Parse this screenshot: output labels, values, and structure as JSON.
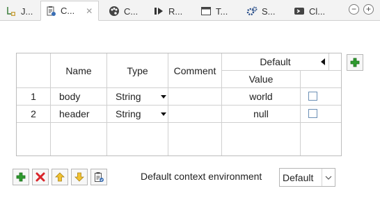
{
  "tabs": [
    {
      "label": "J...",
      "icon": "job-icon"
    },
    {
      "label": "C...",
      "icon": "contexts-icon"
    },
    {
      "label": "C...",
      "icon": "palette-icon"
    },
    {
      "label": "R...",
      "icon": "run-icon"
    },
    {
      "label": "T...",
      "icon": "window-icon"
    },
    {
      "label": "S...",
      "icon": "settings-icon"
    },
    {
      "label": "Cl...",
      "icon": "cloud-icon"
    }
  ],
  "tab_close": "✕",
  "window": {
    "minimize": "−",
    "maximize": "+"
  },
  "table": {
    "headers": {
      "name": "Name",
      "type": "Type",
      "comment": "Comment",
      "default": "Default",
      "value": "Value"
    },
    "rows": [
      {
        "index": "1",
        "name": "body",
        "type": "String",
        "comment": "",
        "value": "world"
      },
      {
        "index": "2",
        "name": "header",
        "type": "String",
        "comment": "",
        "value": "null"
      }
    ]
  },
  "toolbar": {
    "add": "add-icon",
    "remove": "remove-icon",
    "move_up": "up-arrow-icon",
    "move_down": "down-arrow-icon",
    "copy": "clipboard-icon"
  },
  "env": {
    "label": "Default context environment",
    "selected": "Default"
  },
  "colors": {
    "add_green": "#2e9b2e",
    "remove_red": "#d9262b",
    "arrow_yellow": "#f2c230"
  }
}
